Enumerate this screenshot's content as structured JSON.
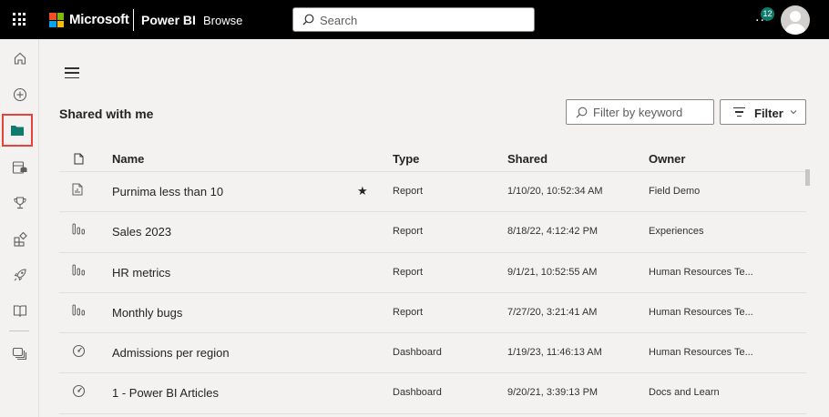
{
  "topbar": {
    "brand": "Microsoft",
    "product": "Power BI",
    "crumb": "Browse",
    "search_placeholder": "Search",
    "more": "...",
    "notification_count": "12"
  },
  "nav": {
    "items": [
      "home-icon",
      "create-icon",
      "browse-icon",
      "onelake-icon",
      "metrics-icon",
      "apps-icon",
      "deployment-icon",
      "learn-icon",
      "workspaces-icon"
    ]
  },
  "page": {
    "title": "Shared with me",
    "filter_placeholder": "Filter by keyword",
    "filter_button": "Filter"
  },
  "table": {
    "columns": {
      "name": "Name",
      "type": "Type",
      "shared": "Shared",
      "owner": "Owner"
    },
    "rows": [
      {
        "icon": "report-icon",
        "name": "Purnima less than 10",
        "favorite": "★",
        "type": "Report",
        "shared": "1/10/20, 10:52:34 AM",
        "owner": "Field Demo"
      },
      {
        "icon": "report-icon",
        "name": "Sales 2023",
        "favorite": "",
        "type": "Report",
        "shared": "8/18/22, 4:12:42 PM",
        "owner": "Experiences"
      },
      {
        "icon": "report-icon",
        "name": "HR metrics",
        "favorite": "",
        "type": "Report",
        "shared": "9/1/21, 10:52:55 AM",
        "owner": "Human Resources Te..."
      },
      {
        "icon": "report-icon",
        "name": "Monthly bugs",
        "favorite": "",
        "type": "Report",
        "shared": "7/27/20, 3:21:41 AM",
        "owner": "Human Resources Te..."
      },
      {
        "icon": "dashboard-icon",
        "name": "Admissions per region",
        "favorite": "",
        "type": "Dashboard",
        "shared": "1/19/23, 11:46:13 AM",
        "owner": "Human Resources Te..."
      },
      {
        "icon": "dashboard-icon",
        "name": "1 - Power BI Articles",
        "favorite": "",
        "type": "Dashboard",
        "shared": "9/20/21, 3:39:13 PM",
        "owner": "Docs and Learn"
      }
    ]
  },
  "colors": {
    "accent": "#0f7b6c",
    "highlight_box": "#e5423c"
  }
}
